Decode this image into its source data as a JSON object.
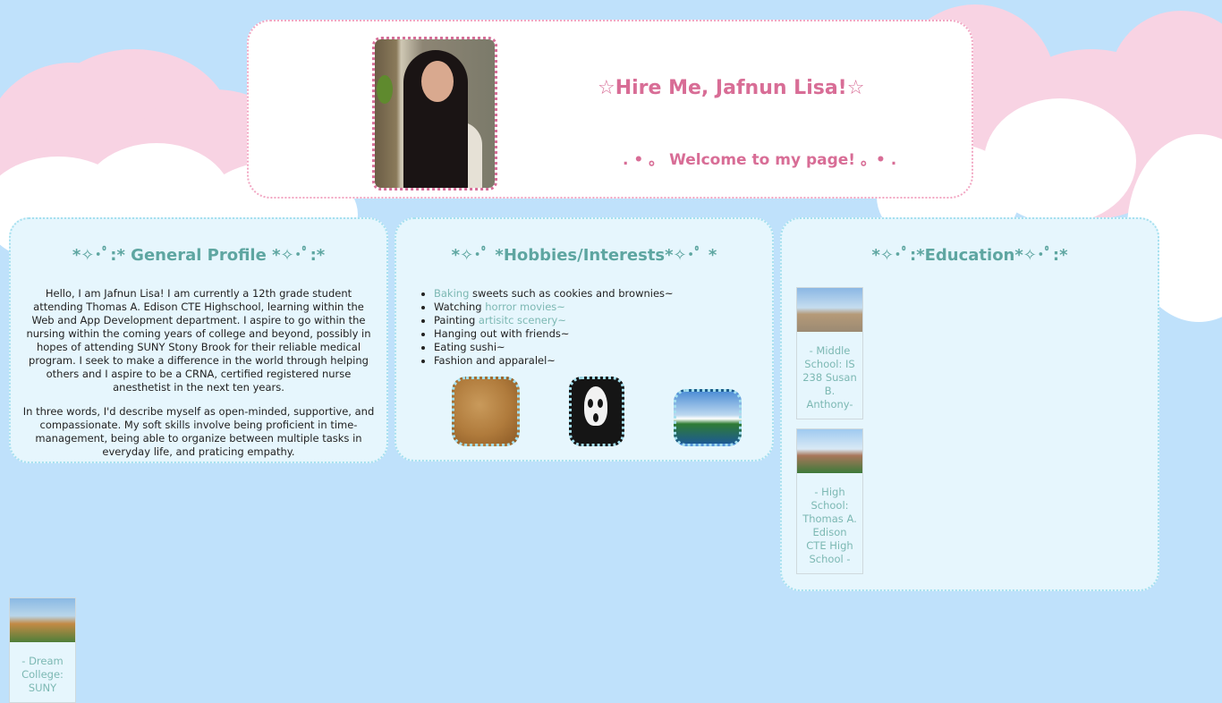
{
  "header": {
    "title": "☆Hire Me, Jafnun Lisa!☆",
    "subtitle": ". • 。 Welcome to my page! 。• ."
  },
  "profile": {
    "title": "*✧･ﾟ:* General Profile *✧･ﾟ:*",
    "paragraphs": [
      "Hello, I am Jafnun Lisa! I am currently a 12th grade student attending Thomas A. Edison CTE Highschool, learning within the Web and App Development department. I aspire to go within the nursing within the coming years of college and beyond, possibly in hopes of attending SUNY Stony Brook for their reliable medical program. I seek to make a difference in the world through helping others and I aspire to be a CRNA, certified registered nurse anesthetist in the next ten years.",
      "In three words, I'd describe myself as open-minded, supportive, and compassionate. My soft skills involve being proficient in time-management, being able to organize between multiple tasks in everyday life, and praticing empathy."
    ]
  },
  "hobbies": {
    "title": "*✧･ﾟ *Hobbies/Interests*✧･ﾟ *",
    "items": [
      {
        "prefix": "",
        "link": "Baking",
        "suffix": " sweets such as cookies and brownies~"
      },
      {
        "prefix": "Watching ",
        "link": "horror movies~",
        "suffix": ""
      },
      {
        "prefix": "Painting ",
        "link": "artisitc scenery~",
        "suffix": ""
      },
      {
        "prefix": "Hanging out with friends~",
        "link": "",
        "suffix": ""
      },
      {
        "prefix": "Eating sushi~",
        "link": "",
        "suffix": ""
      },
      {
        "prefix": "Fashion and apparalel~",
        "link": "",
        "suffix": ""
      }
    ]
  },
  "education": {
    "title": "*✧･ﾟ:*Education*✧･ﾟ:*",
    "schools": [
      {
        "caption": "- Middle School: IS 238 Susan B. Anthony-"
      },
      {
        "caption": "- High School: Thomas A. Edison CTE High School -"
      }
    ],
    "dream": {
      "caption": "- Dream College: SUNY"
    }
  },
  "colors": {
    "background": "#bfe1fb",
    "accent_pink": "#d86d96",
    "accent_teal": "#5ea6a1",
    "card_bg": "#e6f6fd"
  }
}
